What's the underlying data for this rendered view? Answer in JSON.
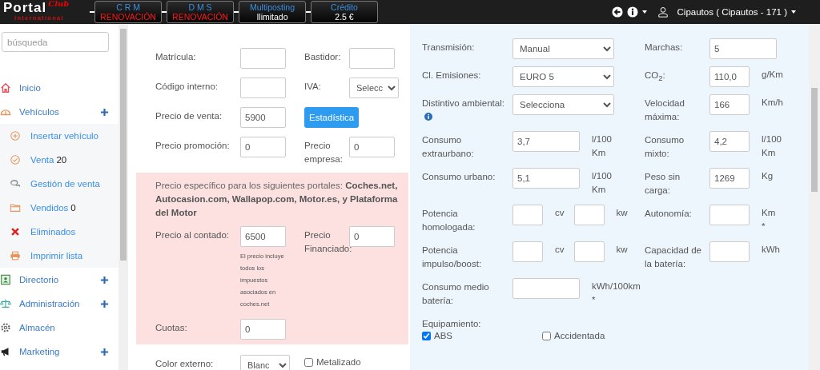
{
  "header": {
    "logo": {
      "name": "Portal",
      "script": "Club",
      "subtitle": "International"
    },
    "tiles": [
      {
        "title": "C R M",
        "status": "RENOVACIÓN",
        "alert": true
      },
      {
        "title": "D M S",
        "status": "RENOVACIÓN",
        "alert": true
      },
      {
        "title": "Multiposting",
        "status": "Ilimitado",
        "alert": false
      },
      {
        "title": "Crédito",
        "status": "2.5 €",
        "alert": false
      }
    ],
    "user": "Cipautos ( Cipautos - 171 )"
  },
  "sidebar": {
    "search": {
      "placeholder": "búsqueda"
    },
    "items": [
      {
        "label": "Inicio",
        "kind": "link"
      },
      {
        "label": "Vehículos",
        "kind": "group",
        "children": [
          {
            "label": "Insertar vehículo"
          },
          {
            "label": "Venta",
            "count": "20"
          },
          {
            "label": "Gestión de venta"
          },
          {
            "label": "Vendidos",
            "count": "0"
          },
          {
            "label": "Eliminados"
          },
          {
            "label": "Imprimir lista"
          }
        ]
      },
      {
        "label": "Directorio",
        "kind": "group"
      },
      {
        "label": "Administración",
        "kind": "group"
      },
      {
        "label": "Almacén",
        "kind": "link"
      },
      {
        "label": "Marketing",
        "kind": "group"
      }
    ]
  },
  "vehicle_form": {
    "rows": [
      {
        "cells": [
          {
            "label": "Matrícula:",
            "control": {
              "kind": "input"
            }
          },
          {
            "label": "Bastidor:",
            "control": {
              "kind": "input"
            }
          }
        ]
      },
      {
        "cells": [
          {
            "label": "Código interno:",
            "control": {
              "kind": "input"
            }
          },
          {
            "label": "IVA:",
            "control": {
              "kind": "select",
              "value": "Selecc"
            }
          }
        ]
      },
      {
        "cells": [
          {
            "label": "Precio de venta:",
            "control": {
              "kind": "input",
              "value": "5900"
            }
          },
          {
            "control": {
              "kind": "button",
              "value": "Estadística"
            }
          }
        ]
      },
      {
        "cells": [
          {
            "label": "Precio promoción:",
            "control": {
              "kind": "input",
              "value": "0"
            }
          },
          {
            "label": "Precio empresa:",
            "control": {
              "kind": "input",
              "value": "0"
            }
          }
        ]
      }
    ],
    "portal_prices": {
      "note": "Precio específico para los siguientes portales: **Coches.net, Autocasion.com, Wallapop.com, Motor.es, y Plataforma del Motor**",
      "rows": [
        {
          "cells": [
            {
              "label": "Precio al contado:",
              "control": {
                "kind": "input",
                "value": "6500",
                "hint": "El precio incluye todos los impuestos asociados en coches.net"
              }
            },
            {
              "label": "Precio Financiado:",
              "control": {
                "kind": "input",
                "value": "0"
              }
            }
          ]
        },
        {
          "cells": [
            {
              "label": "Cuotas:",
              "control": {
                "kind": "input",
                "value": "0"
              }
            }
          ]
        }
      ]
    },
    "rows_after": [
      {
        "cells": [
          {
            "label": "Color externo:",
            "control": {
              "kind": "select",
              "value": "Blanc"
            }
          },
          {
            "control": {
              "kind": "checkbox",
              "value": "Metalizado",
              "checked": false
            }
          }
        ]
      }
    ]
  },
  "specs": {
    "rows": [
      {
        "cells": [
          {
            "label": "Transmisión:",
            "controls": [
              {
                "kind": "select",
                "value": "Manual"
              }
            ]
          },
          {
            "label": "Marchas:",
            "controls": [
              {
                "kind": "input-long",
                "value": "5"
              }
            ]
          }
        ]
      },
      {
        "cells": [
          {
            "label": "Cl. Emisiones:",
            "controls": [
              {
                "kind": "select",
                "value": "EURO 5"
              }
            ]
          },
          {
            "label": "CO$_{2}$:",
            "controls": [
              {
                "kind": "input",
                "value": "110,0",
                "unit": "g/Km"
              }
            ]
          }
        ]
      },
      {
        "cells": [
          {
            "label": "Distintivo ambiental:",
            "info": true,
            "controls": [
              {
                "kind": "select",
                "value": "Selecciona"
              }
            ]
          },
          {
            "label": "Velocidad máxima:",
            "controls": [
              {
                "kind": "input",
                "value": "166",
                "unit": "Km/h"
              }
            ]
          }
        ]
      },
      {
        "cells": [
          {
            "label": "Consumo extraurbano:",
            "controls": [
              {
                "kind": "input-long",
                "value": "3,7",
                "unit": "l/100 Km"
              }
            ]
          },
          {
            "label": "Consumo mixto:",
            "controls": [
              {
                "kind": "input",
                "value": "4,2",
                "unit": "l/100 Km"
              }
            ]
          }
        ]
      },
      {
        "cells": [
          {
            "label": "Consumo urbano:",
            "controls": [
              {
                "kind": "input-long",
                "value": "5,1",
                "unit": "l/100 Km"
              }
            ]
          },
          {
            "label": "Peso sin carga:",
            "controls": [
              {
                "kind": "input",
                "value": "1269",
                "unit": "Kg"
              }
            ]
          }
        ]
      },
      {
        "cells": [
          {
            "label": "Potencia homologada:",
            "controls": [
              {
                "kind": "input-short",
                "unit": "cv"
              },
              {
                "kind": "input-short",
                "unit": "kw"
              }
            ]
          },
          {
            "label": "Autonomía:",
            "controls": [
              {
                "kind": "input",
                "unit": "Km *"
              }
            ]
          }
        ]
      },
      {
        "cells": [
          {
            "label": "Potencia impulso/boost:",
            "controls": [
              {
                "kind": "input-short",
                "unit": "cv"
              },
              {
                "kind": "input-short",
                "unit": "kw"
              }
            ]
          },
          {
            "label": "Capacidad de la batería:",
            "controls": [
              {
                "kind": "input",
                "unit": "kWh"
              }
            ]
          }
        ]
      },
      {
        "cells": [
          {
            "label": "Consumo medio batería:",
            "controls": [
              {
                "kind": "input-long",
                "unit": "kWh/100km *"
              }
            ]
          }
        ]
      }
    ],
    "equipment": {
      "label": "Equipamiento:",
      "items": [
        {
          "label": "ABS",
          "checked": true
        },
        {
          "label": "Accidentada",
          "checked": false
        }
      ]
    }
  }
}
